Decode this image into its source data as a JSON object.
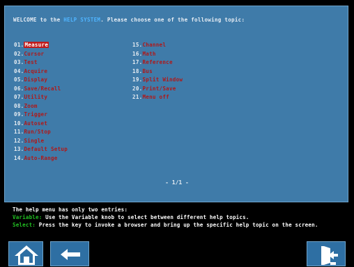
{
  "welcome": {
    "pre": "WELCOME to the ",
    "highlight": "HELP SYSTEM",
    "post": ". Please choose one of the following topic:"
  },
  "topics": [
    {
      "num": "01.",
      "label": "Measure",
      "selected": true
    },
    {
      "num": "02.",
      "label": "Cursor"
    },
    {
      "num": "03.",
      "label": "Test"
    },
    {
      "num": "04.",
      "label": "Acquire"
    },
    {
      "num": "05.",
      "label": "Display"
    },
    {
      "num": "06.",
      "label": "Save/Recall"
    },
    {
      "num": "07.",
      "label": "Utility"
    },
    {
      "num": "08.",
      "label": "Zoom"
    },
    {
      "num": "09.",
      "label": "Trigger"
    },
    {
      "num": "10.",
      "label": "Autoset"
    },
    {
      "num": "11.",
      "label": "Run/Stop"
    },
    {
      "num": "12.",
      "label": "Single"
    },
    {
      "num": "13.",
      "label": "Default Setup"
    },
    {
      "num": "14.",
      "label": "Auto-Range"
    },
    {
      "num": "15.",
      "label": "Channel"
    },
    {
      "num": "16.",
      "label": "Math"
    },
    {
      "num": "17.",
      "label": "Reference"
    },
    {
      "num": "18.",
      "label": "Bus"
    },
    {
      "num": "19.",
      "label": "Split Window"
    },
    {
      "num": "20.",
      "label": "Print/Save"
    },
    {
      "num": "21.",
      "label": "Menu off"
    }
  ],
  "page_indicator": "- 1/1 -",
  "help": {
    "intro": "The help menu has only two entries:",
    "variable_key": "Variable:",
    "variable_text": " Use the Variable knob to select between different help topics.",
    "select_key": "Select:",
    "select_text": " Press the key to invoke a browser and bring up the specific help topic on the screen."
  },
  "buttons": {
    "home_icon": "home-icon",
    "back_icon": "arrow-left-icon",
    "exit_icon": "exit-door-icon"
  },
  "colors": {
    "panel_bg": "#3f7ba9",
    "topic_label": "#b01818",
    "highlight": "#4fb4ff",
    "key_green": "#22c022"
  }
}
